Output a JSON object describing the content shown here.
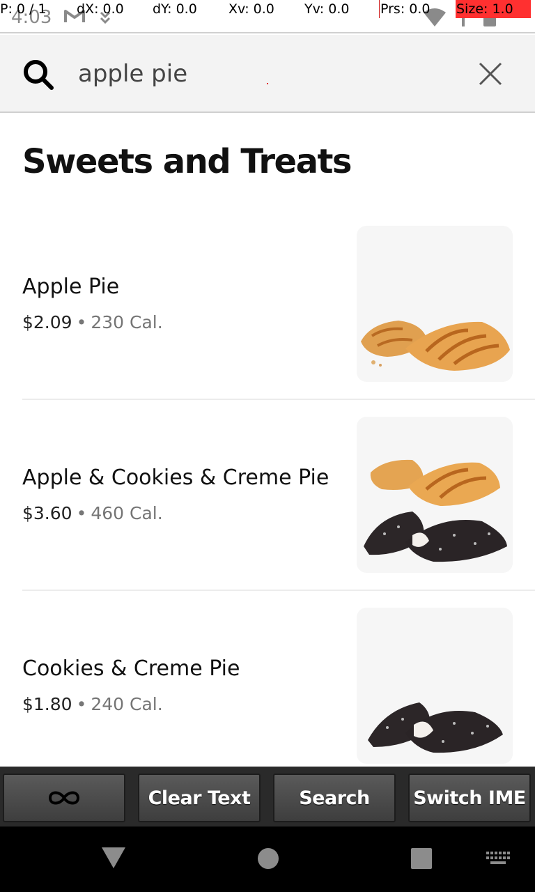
{
  "status_bar": {
    "time": "4:03",
    "overlay": {
      "p": "P: 0 / 1",
      "dx": "dX: 0.0",
      "dy": "dY: 0.0",
      "xv": "Xv: 0.0",
      "yv": "Yv: 0.0",
      "prs": "Prs: 0.0",
      "size": "Size: 1.0"
    }
  },
  "search": {
    "value": "apple pie"
  },
  "section": {
    "title": "Sweets and Treats"
  },
  "items": [
    {
      "name": "Apple Pie",
      "price": "$2.09",
      "separator": "•",
      "calories": "230 Cal."
    },
    {
      "name": "Apple & Cookies & Creme Pie",
      "price": "$3.60",
      "separator": "•",
      "calories": "460 Cal."
    },
    {
      "name": "Cookies & Creme Pie",
      "price": "$1.80",
      "separator": "•",
      "calories": "240 Cal."
    }
  ],
  "ime_toolbar": {
    "clear_text": "Clear Text",
    "search": "Search",
    "switch_ime": "Switch IME"
  },
  "colors": {
    "accent_overlay": "#ff3030",
    "search_bg": "#f3f3f3",
    "toolbar_bg": "#2a2a2a"
  }
}
